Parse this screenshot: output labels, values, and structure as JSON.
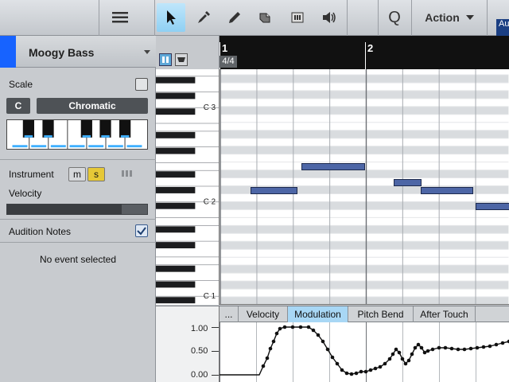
{
  "toolbar": {
    "tools": [
      {
        "name": "arrow-tool",
        "icon": "arrow-icon",
        "active": true
      },
      {
        "name": "eyedropper-tool",
        "icon": "eyedropper-icon"
      },
      {
        "name": "pencil-tool",
        "icon": "pencil-icon"
      },
      {
        "name": "eraser-tool",
        "icon": "eraser-icon"
      },
      {
        "name": "mute-tool",
        "icon": "mute-icon"
      },
      {
        "name": "listen-tool",
        "icon": "speaker-icon"
      }
    ],
    "quantize_label": "Q",
    "action_label": "Action",
    "corner_text": "Au"
  },
  "inspector": {
    "track_name": "Moogy Bass",
    "track_color": "#1763ff",
    "scale_label": "Scale",
    "scale_checked": false,
    "key_root": "C",
    "scale_type": "Chromatic",
    "instrument_label": "Instrument",
    "mute_label": "m",
    "solo_label": "s",
    "velocity_label": "Velocity",
    "velocity_level": 0.82,
    "audition_label": "Audition Notes",
    "audition_checked": true,
    "status_text": "No event selected"
  },
  "piano": {
    "labels": [
      "C 3",
      "C 2",
      "C 1"
    ]
  },
  "ruler": {
    "bars": [
      "1",
      "2"
    ],
    "time_signature": "4/4"
  },
  "lane": {
    "more_label": "...",
    "tabs": [
      "Velocity",
      "Modulation",
      "Pitch Bend",
      "After Touch"
    ],
    "active_tab": "Modulation",
    "axis_labels": [
      "1.00",
      "0.50",
      "0.00"
    ]
  },
  "colors": {
    "accent_blue": "#1763ff",
    "note_fill": "#4d66a6",
    "tab_active": "#a8d7f5",
    "solo_yellow": "#e6c837"
  }
}
